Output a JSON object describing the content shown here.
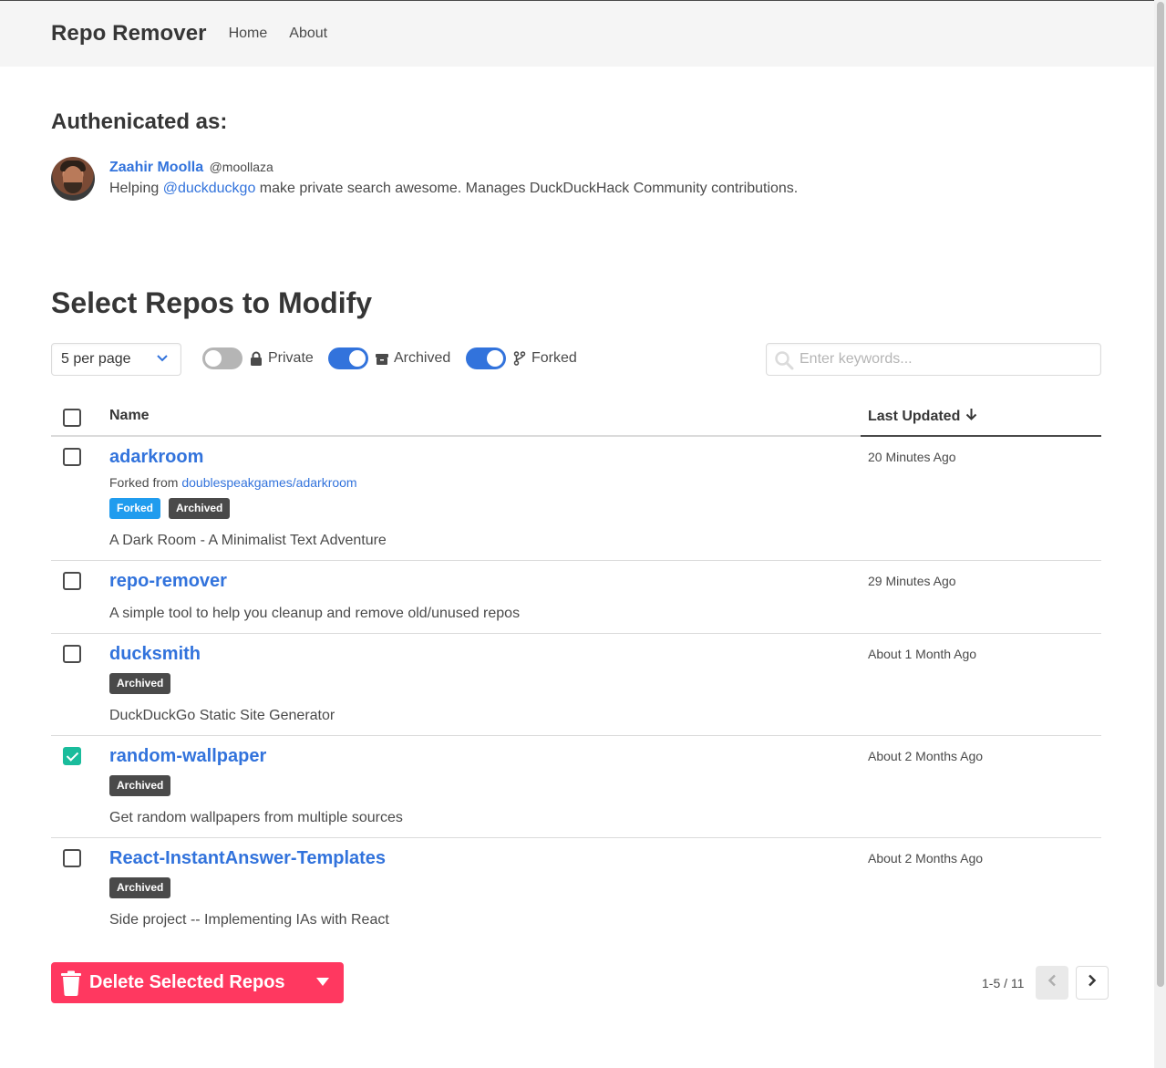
{
  "nav": {
    "brand": "Repo Remover",
    "links": [
      "Home",
      "About"
    ]
  },
  "auth": {
    "title": "Authenicated as:",
    "user": {
      "name": "Zaahir Moolla",
      "handle": "@moollaza",
      "bio_prefix": "Helping ",
      "bio_link": "@duckduckgo",
      "bio_suffix": " make private search awesome. Manages DuckDuckHack Community contributions."
    }
  },
  "select": {
    "title": "Select Repos to Modify",
    "per_page": "5 per page",
    "toggles": [
      {
        "label": "Private",
        "on": false,
        "icon": "lock-icon"
      },
      {
        "label": "Archived",
        "on": true,
        "icon": "archive-icon"
      },
      {
        "label": "Forked",
        "on": true,
        "icon": "fork-icon"
      }
    ],
    "search_placeholder": "Enter keywords..."
  },
  "table": {
    "headers": {
      "name": "Name",
      "updated": "Last Updated"
    },
    "rows": [
      {
        "name": "adarkroom",
        "forked_from_label": "Forked from ",
        "forked_from": "doublespeakgames/adarkroom",
        "tags": [
          "Forked",
          "Archived"
        ],
        "description": "A Dark Room - A Minimalist Text Adventure",
        "updated": "20 Minutes Ago",
        "checked": false
      },
      {
        "name": "repo-remover",
        "tags": [],
        "description": "A simple tool to help you cleanup and remove old/unused repos",
        "updated": "29 Minutes Ago",
        "checked": false
      },
      {
        "name": "ducksmith",
        "tags": [
          "Archived"
        ],
        "description": "DuckDuckGo Static Site Generator",
        "updated": "About 1 Month Ago",
        "checked": false
      },
      {
        "name": "random-wallpaper",
        "tags": [
          "Archived"
        ],
        "description": "Get random wallpapers from multiple sources",
        "updated": "About 2 Months Ago",
        "checked": true
      },
      {
        "name": "React-InstantAnswer-Templates",
        "tags": [
          "Archived"
        ],
        "description": "Side project -- Implementing IAs with React",
        "updated": "About 2 Months Ago",
        "checked": false
      }
    ]
  },
  "actions": {
    "delete_label": "Delete Selected Repos",
    "page_info": "1-5 / 11"
  },
  "colors": {
    "link": "#3273dc",
    "danger": "#ff3860",
    "forked_tag": "#209cee",
    "archived_tag": "#4a4a4a",
    "checked": "#1abc9c"
  }
}
